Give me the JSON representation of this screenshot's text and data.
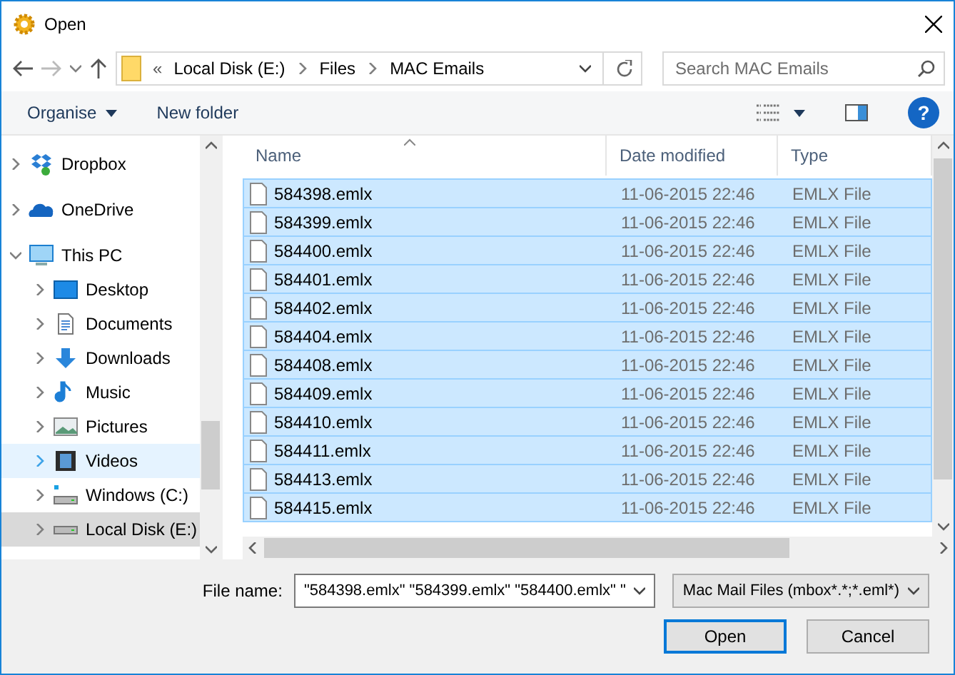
{
  "window": {
    "title": "Open"
  },
  "address": {
    "overflow": "«",
    "crumbs": [
      "Local Disk (E:)",
      "Files",
      "MAC Emails"
    ]
  },
  "search": {
    "placeholder": "Search MAC Emails"
  },
  "toolbar": {
    "organise": "Organise",
    "new_folder": "New folder",
    "help": "?"
  },
  "sidebar": {
    "items": [
      {
        "label": "Dropbox",
        "kind": "dropbox",
        "expanded": false,
        "selected": false,
        "hovered": false
      },
      {
        "label": "OneDrive",
        "kind": "cloud",
        "expanded": false,
        "selected": false,
        "hovered": false
      },
      {
        "label": "This PC",
        "kind": "pc",
        "expanded": true,
        "selected": false,
        "hovered": false,
        "children": [
          {
            "label": "Desktop",
            "kind": "desktop",
            "expanded": false,
            "selected": false,
            "hovered": false
          },
          {
            "label": "Documents",
            "kind": "document",
            "expanded": false,
            "selected": false,
            "hovered": false
          },
          {
            "label": "Downloads",
            "kind": "download",
            "expanded": false,
            "selected": false,
            "hovered": false
          },
          {
            "label": "Music",
            "kind": "music",
            "expanded": false,
            "selected": false,
            "hovered": false
          },
          {
            "label": "Pictures",
            "kind": "picture",
            "expanded": false,
            "selected": false,
            "hovered": false
          },
          {
            "label": "Videos",
            "kind": "video",
            "expanded": false,
            "selected": false,
            "hovered": true
          },
          {
            "label": "Windows (C:)",
            "kind": "windrive",
            "expanded": false,
            "selected": false,
            "hovered": false
          },
          {
            "label": "Local Disk (E:)",
            "kind": "drive",
            "expanded": false,
            "selected": true,
            "hovered": false
          }
        ]
      }
    ]
  },
  "table": {
    "columns": [
      "Name",
      "Date modified",
      "Type"
    ],
    "rows": [
      {
        "name": "584398.emlx",
        "date": "11-06-2015 22:46",
        "type": "EMLX File",
        "selected": true
      },
      {
        "name": "584399.emlx",
        "date": "11-06-2015 22:46",
        "type": "EMLX File",
        "selected": true
      },
      {
        "name": "584400.emlx",
        "date": "11-06-2015 22:46",
        "type": "EMLX File",
        "selected": true
      },
      {
        "name": "584401.emlx",
        "date": "11-06-2015 22:46",
        "type": "EMLX File",
        "selected": true
      },
      {
        "name": "584402.emlx",
        "date": "11-06-2015 22:46",
        "type": "EMLX File",
        "selected": true
      },
      {
        "name": "584404.emlx",
        "date": "11-06-2015 22:46",
        "type": "EMLX File",
        "selected": true
      },
      {
        "name": "584408.emlx",
        "date": "11-06-2015 22:46",
        "type": "EMLX File",
        "selected": true
      },
      {
        "name": "584409.emlx",
        "date": "11-06-2015 22:46",
        "type": "EMLX File",
        "selected": true
      },
      {
        "name": "584410.emlx",
        "date": "11-06-2015 22:46",
        "type": "EMLX File",
        "selected": true
      },
      {
        "name": "584411.emlx",
        "date": "11-06-2015 22:46",
        "type": "EMLX File",
        "selected": true
      },
      {
        "name": "584413.emlx",
        "date": "11-06-2015 22:46",
        "type": "EMLX File",
        "selected": true
      },
      {
        "name": "584415.emlx",
        "date": "11-06-2015 22:46",
        "type": "EMLX File",
        "selected": true
      }
    ]
  },
  "footer": {
    "file_name_label": "File name:",
    "file_name_value": "\"584398.emlx\" \"584399.emlx\" \"584400.emlx\" \"",
    "filter": "Mac Mail Files (mbox*.*;*.eml*)",
    "open": "Open",
    "cancel": "Cancel"
  }
}
